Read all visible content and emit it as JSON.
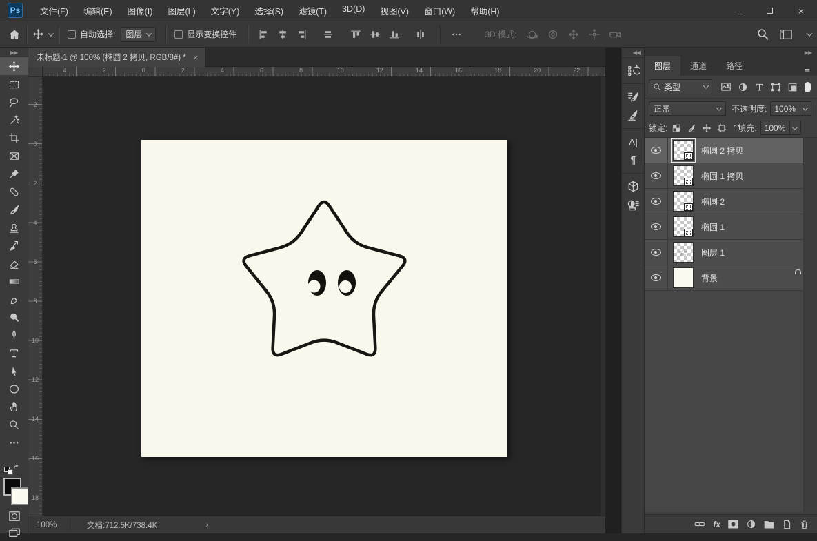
{
  "window": {
    "app_logo": "Ps",
    "controls": [
      "minimize",
      "maximize",
      "close"
    ]
  },
  "menubar": {
    "items": [
      "文件(F)",
      "编辑(E)",
      "图像(I)",
      "图层(L)",
      "文字(Y)",
      "选择(S)",
      "滤镜(T)",
      "3D(D)",
      "视图(V)",
      "窗口(W)",
      "帮助(H)"
    ]
  },
  "options_bar": {
    "auto_select_label": "自动选择:",
    "auto_select_value": "图层",
    "show_transform_label": "显示变换控件",
    "mode_3d_label": "3D 模式:",
    "tool_icons": [
      "home-icon",
      "move-tool-icon",
      "align-left-icon",
      "align-center-h-icon",
      "align-right-icon",
      "distribute-h-icon",
      "align-top-icon",
      "align-middle-icon",
      "align-bottom-icon",
      "distribute-v-icon",
      "more-options-icon",
      "orbit-3d-icon",
      "roll-3d-icon",
      "pan-3d-icon",
      "slide-3d-icon",
      "camera-3d-icon",
      "search-icon",
      "workspace-icon"
    ]
  },
  "document_tab": {
    "title": "未标题-1 @ 100% (椭圆 2 拷贝, RGB/8#) *",
    "close": "×"
  },
  "rulers": {
    "horizontal": [
      "4",
      "2",
      "0",
      "2",
      "4",
      "6",
      "8",
      "10",
      "12",
      "14",
      "16",
      "18",
      "20",
      "22"
    ],
    "vertical": [
      "2",
      "0",
      "2",
      "4",
      "6",
      "8",
      "10",
      "12",
      "14",
      "16",
      "18"
    ]
  },
  "toolbar": {
    "tools": [
      "move (selected)",
      "rectangular-marquee",
      "lasso",
      "magic-wand",
      "crop",
      "frame",
      "eyedropper",
      "spot-healing",
      "brush",
      "clone-stamp",
      "history-brush",
      "eraser",
      "gradient",
      "smudge",
      "dodge",
      "pen",
      "type",
      "path-selection",
      "ellipse-shape",
      "hand",
      "zoom",
      "more-tools"
    ],
    "foreground_color": "#0b0b0b",
    "background_color": "#fbfaf0"
  },
  "canvas": {
    "zoom": "100%",
    "background": "#faf8ec",
    "drawing": "black outline cartoon five-point star with two oval eyes with white highlights"
  },
  "dock_strip": {
    "icons": [
      "history-icon",
      "brush-settings-icon",
      "brushes-icon",
      "character-icon",
      "paragraph-icon",
      "3d-icon",
      "3d-materials-icon"
    ],
    "character_glyph": "A|",
    "paragraph_glyph": "¶"
  },
  "layers_panel": {
    "tabs": [
      {
        "label": "图层",
        "active": true
      },
      {
        "label": "通道",
        "active": false
      },
      {
        "label": "路径",
        "active": false
      }
    ],
    "filter_label": "类型",
    "blend_mode": "正常",
    "opacity_label": "不透明度:",
    "opacity_value": "100%",
    "lock_label": "锁定:",
    "fill_label": "填充:",
    "fill_value": "100%",
    "layers": [
      {
        "name": "椭圆 2 拷贝",
        "selected": true,
        "type": "shape",
        "visible": true
      },
      {
        "name": "椭圆 1 拷贝",
        "selected": false,
        "type": "shape",
        "visible": true
      },
      {
        "name": "椭圆 2",
        "selected": false,
        "type": "shape",
        "visible": true
      },
      {
        "name": "椭圆 1",
        "selected": false,
        "type": "shape",
        "visible": true
      },
      {
        "name": "图层 1",
        "selected": false,
        "type": "raster",
        "visible": true
      },
      {
        "name": "背景",
        "selected": false,
        "type": "background",
        "visible": true,
        "locked": true
      }
    ],
    "footer_icons": [
      "link-icon",
      "fx-icon",
      "layer-mask-icon",
      "adjustment-layer-icon",
      "group-folder-icon",
      "new-layer-icon",
      "trash-icon"
    ]
  },
  "status_bar": {
    "zoom": "100%",
    "document_info": "文档:712.5K/738.4K",
    "chevron": "›"
  },
  "colors": {
    "selection_row": "#626262",
    "panel_bg": "#3f3f3f",
    "pasteboard": "#262626",
    "canvas_cream": "#faf8ec",
    "logo_blue": "#7cc0f7"
  }
}
